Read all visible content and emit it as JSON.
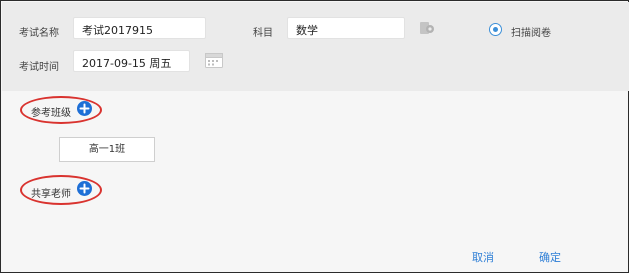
{
  "exam": {
    "name_label": "考试名称",
    "name_value": "考试2017915",
    "subject_label": "科目",
    "subject_value": "数学",
    "scan_label": "扫描阅卷",
    "time_label": "考试时间",
    "time_value": "2017-09-15  周五"
  },
  "classes": {
    "title": "参考班级",
    "items": [
      "高一1班"
    ]
  },
  "teachers": {
    "title": "共享老师"
  },
  "footer": {
    "cancel": "取消",
    "confirm": "确定"
  },
  "colors": {
    "accent": "#1e6fd6",
    "annotation": "#d9332f",
    "link": "#2f7fd6"
  }
}
